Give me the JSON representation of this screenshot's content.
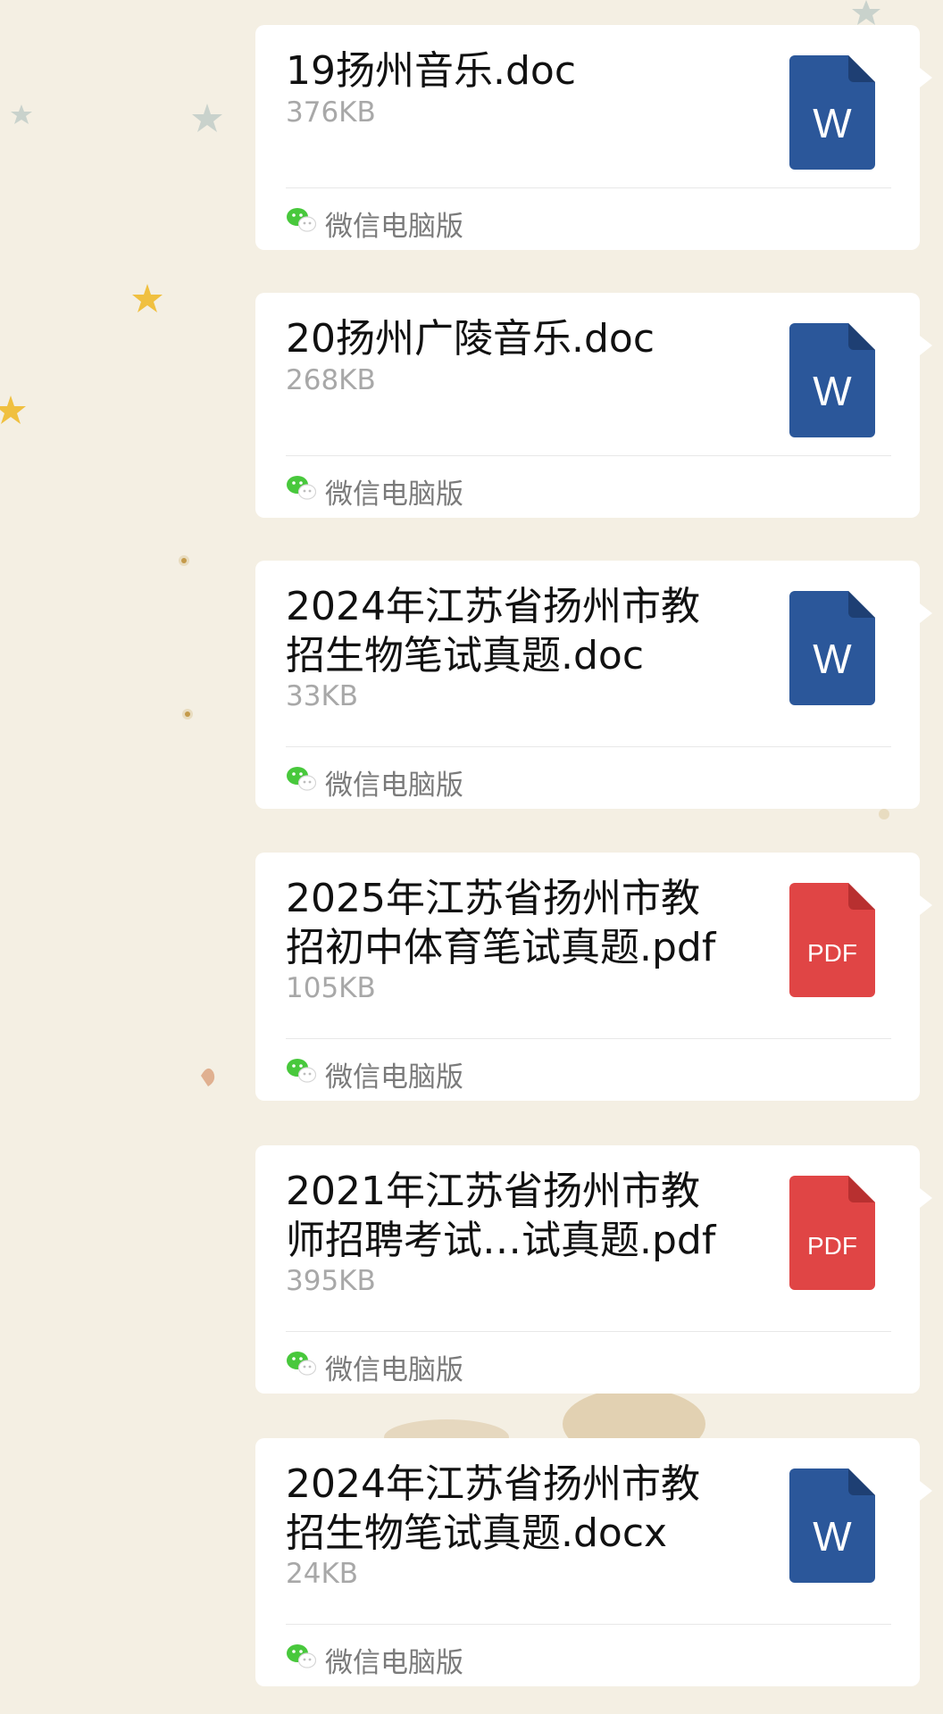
{
  "source_label": "微信电脑版",
  "messages": [
    {
      "name": "19扬州音乐.doc",
      "size": "376KB",
      "type": "word",
      "icon_label": "W"
    },
    {
      "name": "20扬州广陵音乐.doc",
      "size": "268KB",
      "type": "word",
      "icon_label": "W"
    },
    {
      "name": "2024年江苏省扬州市教\n招生物笔试真题.doc",
      "size": "33KB",
      "type": "word",
      "icon_label": "W"
    },
    {
      "name": "2025年江苏省扬州市教\n招初中体育笔试真题.pdf",
      "size": "105KB",
      "type": "pdf",
      "icon_label": "PDF"
    },
    {
      "name": "2021年江苏省扬州市教\n师招聘考试…试真题.pdf",
      "size": "395KB",
      "type": "pdf",
      "icon_label": "PDF"
    },
    {
      "name": "2024年江苏省扬州市教\n招生物笔试真题.docx",
      "size": "24KB",
      "type": "word",
      "icon_label": "W"
    }
  ],
  "colors": {
    "word": "#2b579a",
    "word_fold": "#1e3f73",
    "pdf": "#e04545",
    "pdf_fold": "#b83030",
    "wechat": "#48c83c"
  }
}
